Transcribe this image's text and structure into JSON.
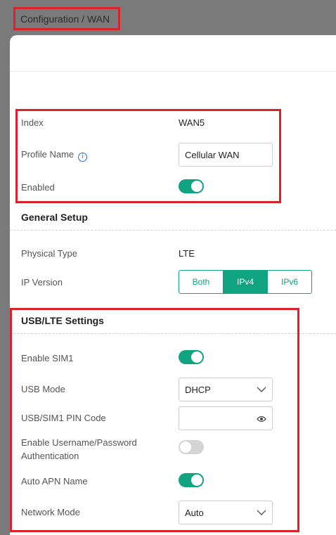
{
  "breadcrumb": "Configuration / WAN",
  "basic": {
    "index_label": "Index",
    "index_value": "WAN5",
    "profile_name_label": "Profile Name",
    "profile_name_value": "Cellular WAN",
    "enabled_label": "Enabled",
    "enabled_state": true
  },
  "general_setup": {
    "title": "General Setup",
    "physical_type_label": "Physical Type",
    "physical_type_value": "LTE",
    "ip_version_label": "IP Version",
    "ip_version_options": [
      "Both",
      "IPv4",
      "IPv6"
    ],
    "ip_version_selected": "IPv4"
  },
  "usb_lte": {
    "title": "USB/LTE Settings",
    "enable_sim1_label": "Enable SIM1",
    "enable_sim1_state": true,
    "usb_mode_label": "USB Mode",
    "usb_mode_value": "DHCP",
    "pin_code_label": "USB/SIM1 PIN Code",
    "pin_code_value": "",
    "auth_label_line1": "Enable Username/Password",
    "auth_label_line2": "Authentication",
    "auth_state": false,
    "auto_apn_label": "Auto APN Name",
    "auto_apn_state": true,
    "network_mode_label": "Network Mode",
    "network_mode_value": "Auto"
  },
  "colors": {
    "accent": "#10a37f",
    "highlight": "#d8232a",
    "info": "#1a73e8"
  }
}
